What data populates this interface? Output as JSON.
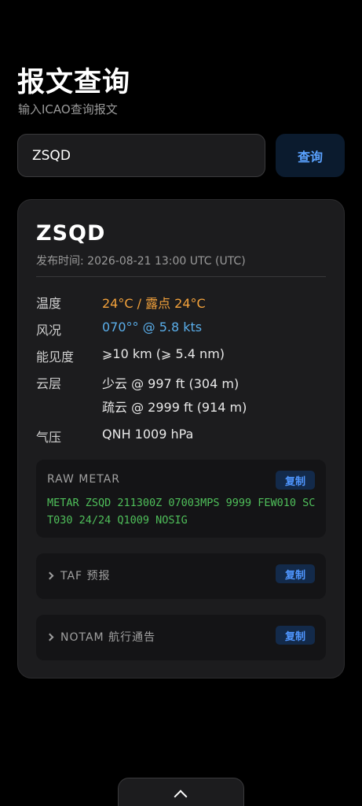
{
  "header": {
    "title": "报文查询",
    "subtitle": "输入ICAO查询报文"
  },
  "search": {
    "value": "ZSQD",
    "button_label": "查询"
  },
  "result": {
    "station": "ZSQD",
    "publish_time": "发布时间: 2026-08-21 13:00 UTC (UTC)",
    "rows": [
      {
        "label": "温度",
        "value": "24°C / 露点 24°C"
      },
      {
        "label": "风况",
        "value": "070°° @ 5.8 kts"
      },
      {
        "label": "能见度",
        "value": "⩾10 km (⩾ 5.4 nm)"
      },
      {
        "label": "云层",
        "value": "少云 @ 997 ft (304 m)",
        "value2": "疏云 @ 2999 ft (914 m)"
      },
      {
        "label": "气压",
        "value": "QNH 1009 hPa"
      }
    ],
    "raw_metar": {
      "title": "RAW METAR",
      "copy_label": "复制",
      "text": "METAR ZSQD 211300Z 07003MPS 9999 FEW010 SCT030 24/24 Q1009 NOSIG"
    },
    "taf": {
      "title": "TAF 预报",
      "copy_label": "复制"
    },
    "notam": {
      "title": "NOTAM 航行通告",
      "copy_label": "复制"
    }
  },
  "colors": {
    "accent": "#5aa2ff",
    "temperature": "#f2a13b",
    "wind": "#5aaeea",
    "metar_text": "#4fbf5a"
  },
  "icons": {
    "bottom": "chevron-up-icon",
    "expand": "chevron-right-icon"
  }
}
